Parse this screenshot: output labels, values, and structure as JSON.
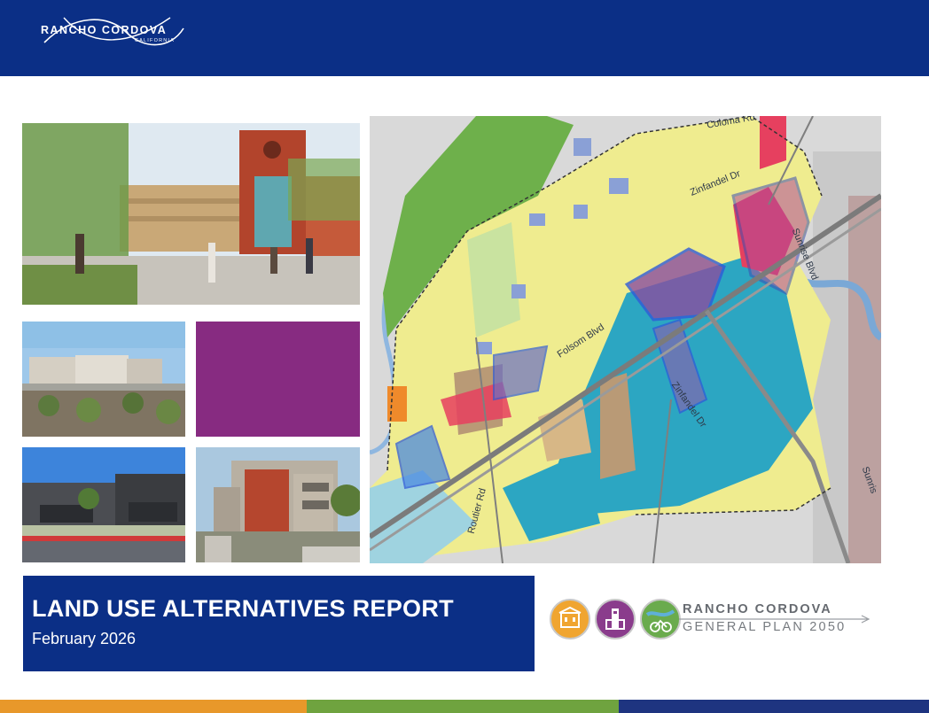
{
  "colors": {
    "header_blue": "#0b2f86",
    "title_blue": "#0b2f86",
    "purple": "#872b81",
    "stripe_orange": "#e8982a",
    "stripe_green": "#6fa33f",
    "stripe_navy": "#1e3480",
    "icon_orange": "#f0a530",
    "icon_purple": "#8a3c8c",
    "icon_green": "#6aab4d"
  },
  "header": {
    "logo_text": "RANCHO CORDOVA",
    "logo_subtext": "CALIFORNIA"
  },
  "map": {
    "labels": [
      "Coloma Rd",
      "Zinfandel Dr",
      "Folsom Blvd",
      "Sunrise Blvd",
      "Zinfandel Dr",
      "Routier Rd",
      "Sunris"
    ]
  },
  "report": {
    "title": "LAND USE ALTERNATIVES REPORT",
    "date": "February 2026"
  },
  "plan_logo": {
    "line1": "RANCHO CORDOVA",
    "line2": "GENERAL PLAN 2050",
    "icons": [
      "building-icon",
      "tower-icon",
      "cyclist-icon"
    ]
  },
  "stripes": [
    {
      "name": "orange"
    },
    {
      "name": "green"
    },
    {
      "name": "navy"
    }
  ]
}
